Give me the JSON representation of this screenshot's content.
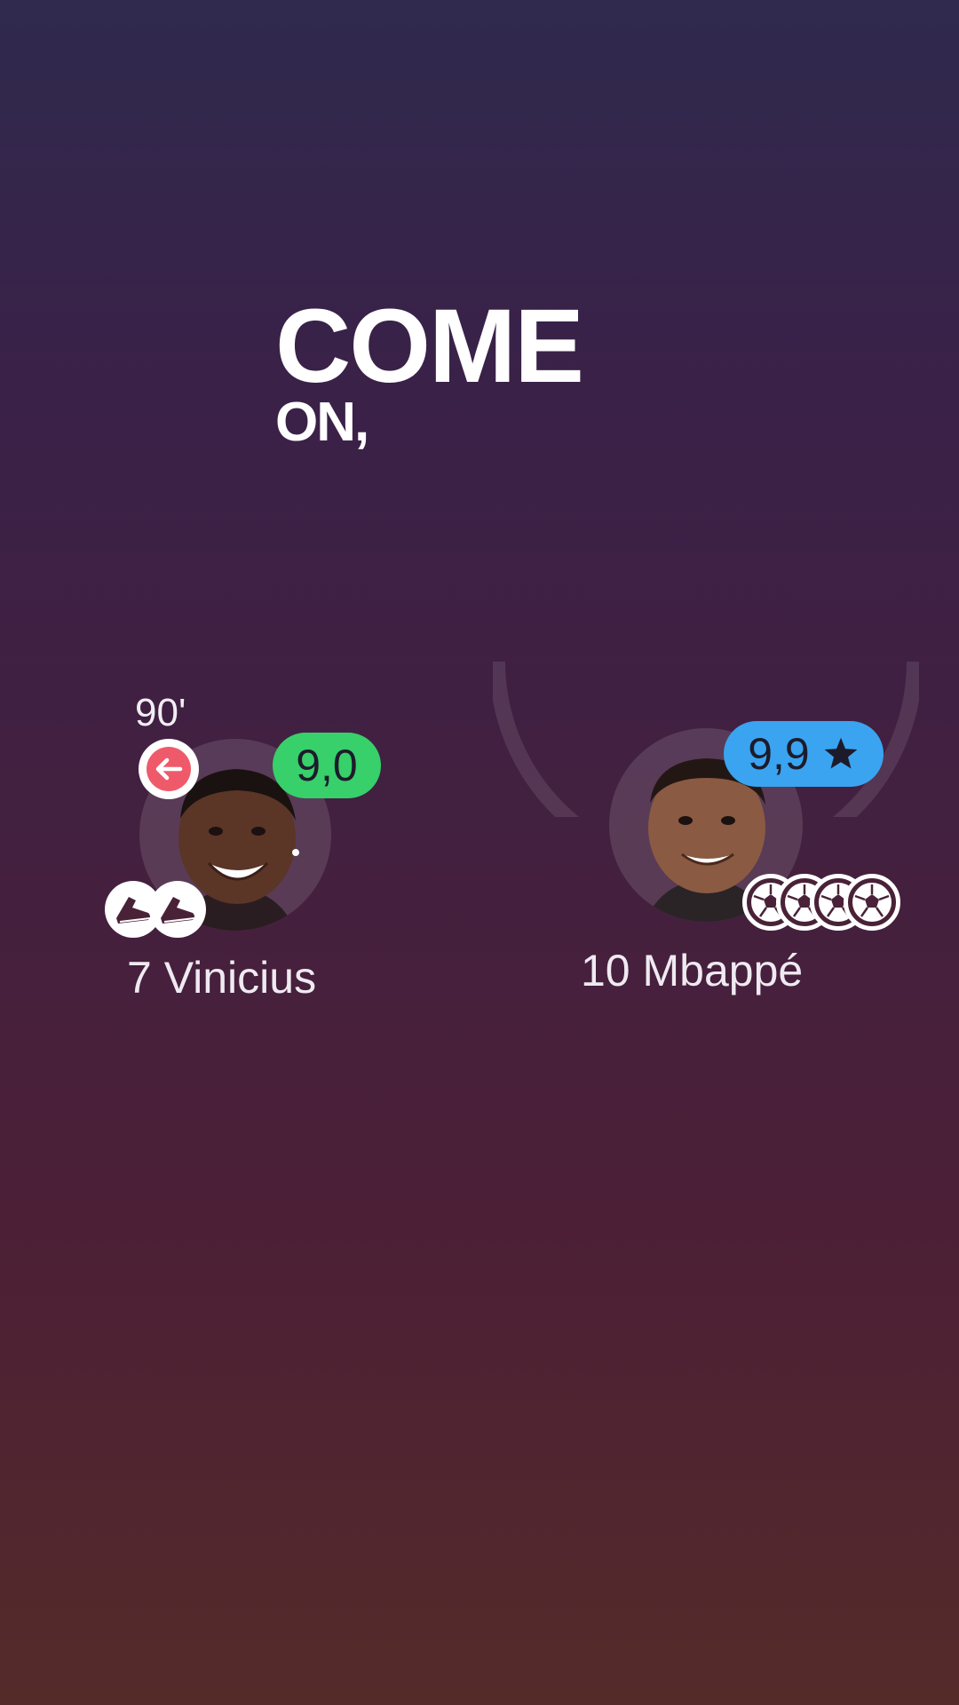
{
  "headline": {
    "line1": "COME",
    "line2": "ON,"
  },
  "players": {
    "left": {
      "minute": "90'",
      "rating": "9,0",
      "name": "7 Vinicius",
      "sub_icon": "arrow-left-icon",
      "badges": [
        "boot-icon",
        "boot-icon"
      ]
    },
    "right": {
      "rating": "9,9",
      "rating_icon": "star-icon",
      "name": "10 Mbappé",
      "badges": [
        "football-icon",
        "football-icon",
        "football-icon",
        "football-icon"
      ]
    }
  },
  "colors": {
    "rating_green": "#37d06a",
    "rating_blue": "#3aa4f0",
    "sub_red": "#ef5a6a"
  }
}
